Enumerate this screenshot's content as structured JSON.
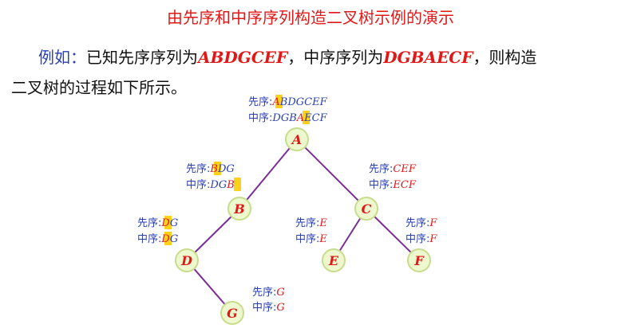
{
  "title": "由先序和中序序列构造二叉树示例的演示",
  "intro": {
    "example_label": "例如：",
    "text1": "已知先序序列为",
    "preorder": "ABDGCEF",
    "comma1": "，",
    "text2": "中序序列为",
    "inorder": "DGBAECF",
    "text3": "，则构造",
    "line2": "二叉树的过程如下所示。"
  },
  "annotation_labels": {
    "pre": "先序:",
    "in": "中序:"
  },
  "nodes": [
    {
      "id": "A",
      "label": "A"
    },
    {
      "id": "B",
      "label": "B"
    },
    {
      "id": "C",
      "label": "C"
    },
    {
      "id": "D",
      "label": "D"
    },
    {
      "id": "E",
      "label": "E"
    },
    {
      "id": "F",
      "label": "F"
    },
    {
      "id": "G",
      "label": "G"
    }
  ],
  "edges": [
    {
      "from": "A",
      "to": "B"
    },
    {
      "from": "A",
      "to": "C"
    },
    {
      "from": "B",
      "to": "D"
    },
    {
      "from": "D",
      "to": "G"
    },
    {
      "from": "C",
      "to": "E"
    },
    {
      "from": "C",
      "to": "F"
    }
  ],
  "annotations": {
    "A": {
      "pre_hl": "A",
      "pre_rest": "BDGCEF",
      "in_before": "DGB",
      "in_hl": "A",
      "in_after": "ECF"
    },
    "B": {
      "pre_hl": "B",
      "pre_rest": "DG",
      "in_before": "DG",
      "in_hl": "B",
      "in_after": ""
    },
    "C": {
      "pre": "CEF",
      "in": "ECF"
    },
    "D": {
      "pre_hl": "D",
      "pre_rest": "G",
      "in_before": "",
      "in_hl": "D",
      "in_after": "G"
    },
    "E": {
      "pre": "E",
      "in": "E"
    },
    "F": {
      "pre": "F",
      "in": "F"
    },
    "G": {
      "pre": "G",
      "in": "G"
    }
  },
  "colors": {
    "title": "#e01818",
    "label": "#2a3fb4",
    "sequence": "#e01818",
    "edge": "#7a2e96",
    "node_fill": "#eef8cf",
    "highlight": "#ffd11a"
  }
}
